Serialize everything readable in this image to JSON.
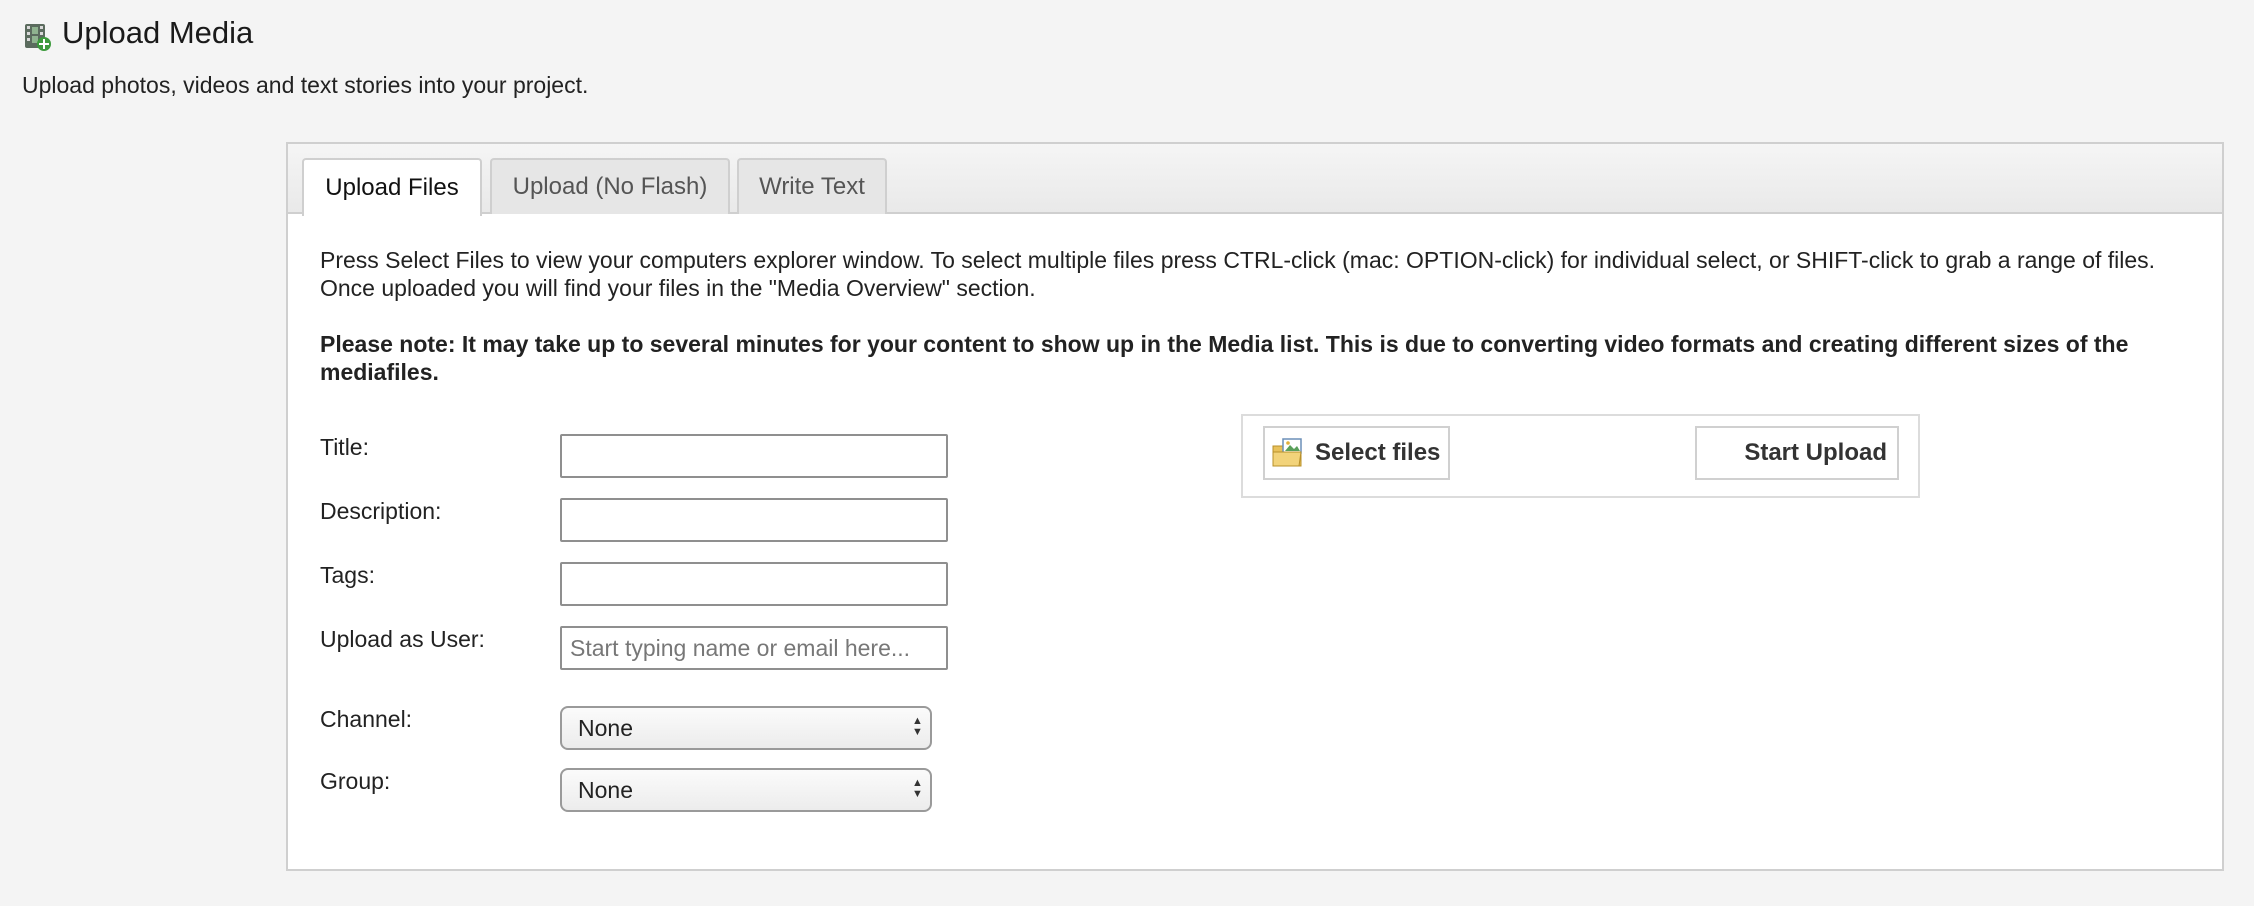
{
  "page": {
    "title": "Upload Media",
    "subtitle": "Upload photos, videos and text stories into your project."
  },
  "tabs": [
    {
      "label": "Upload Files",
      "active": true
    },
    {
      "label": "Upload (No Flash)",
      "active": false
    },
    {
      "label": "Write Text",
      "active": false
    }
  ],
  "content": {
    "intro": "Press Select Files to view your computers explorer window. To select multiple files press CTRL-click (mac: OPTION-click) for individual select, or SHIFT-click to grab a range of files. Once uploaded you will find your files in the \"Media Overview\" section.",
    "note": "Please note: It may take up to several minutes for your content to show up in the Media list. This is due to converting video formats and creating different sizes of the mediafiles."
  },
  "form": {
    "title": {
      "label": "Title:",
      "value": ""
    },
    "description": {
      "label": "Description:",
      "value": ""
    },
    "tags": {
      "label": "Tags:",
      "value": ""
    },
    "upload_as_user": {
      "label": "Upload as User:",
      "placeholder": "Start typing name or email here..."
    },
    "channel": {
      "label": "Channel:",
      "selected": "None"
    },
    "group": {
      "label": "Group:",
      "selected": "None"
    }
  },
  "uploader": {
    "select_files_label": "Select files",
    "start_upload_label": "Start Upload"
  },
  "icons": {
    "page_icon": "media-film-add-icon",
    "select_files_icon": "folder-image-icon"
  },
  "colors": {
    "background": "#f4f4f4",
    "panel_border": "#cfcfcf",
    "text": "#222222"
  }
}
